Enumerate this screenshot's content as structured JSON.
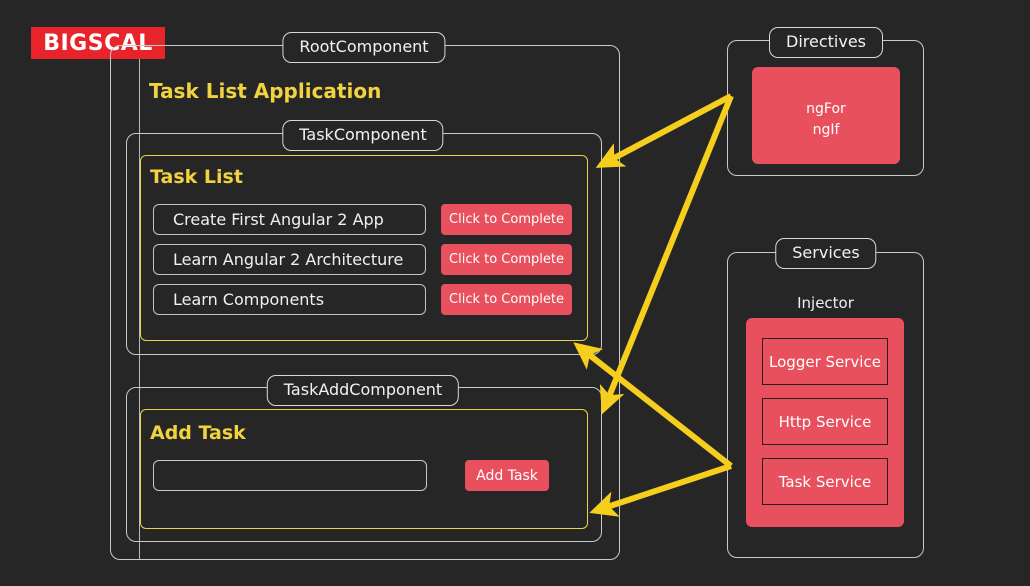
{
  "brand": {
    "logo_text": "BIGSCAL"
  },
  "root": {
    "label": "RootComponent",
    "app_title": "Task List Application"
  },
  "task_component": {
    "label": "TaskComponent",
    "panel_title": "Task List",
    "tasks": [
      {
        "name": "Create First Angular 2 App",
        "button": "Click to Complete"
      },
      {
        "name": "Learn Angular 2 Architecture",
        "button": "Click to Complete"
      },
      {
        "name": "Learn Components",
        "button": "Click to Complete"
      }
    ]
  },
  "task_add_component": {
    "label": "TaskAddComponent",
    "panel_title": "Add Task",
    "input_value": "",
    "input_placeholder": "",
    "add_button": "Add Task"
  },
  "directives": {
    "label": "Directives",
    "items": [
      "ngFor",
      "ngIf"
    ]
  },
  "services": {
    "label": "Services",
    "injector_label": "Injector",
    "items": [
      "Logger Service",
      "Http Service",
      "Task Service"
    ]
  },
  "colors": {
    "background": "#262626",
    "brand_red": "#E8232A",
    "accent_red": "#E8505E",
    "accent_yellow": "#EFD14B",
    "title_yellow": "#F2D23F",
    "border_gray": "#C9C9C9",
    "arrow_yellow": "#F5CE1E"
  }
}
